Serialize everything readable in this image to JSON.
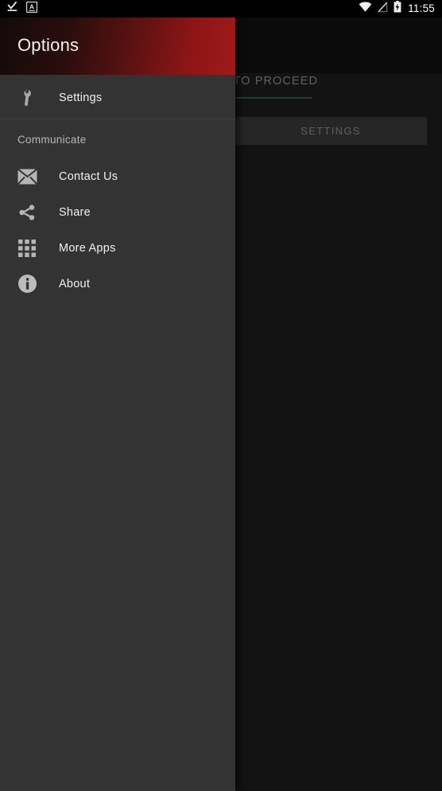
{
  "status_bar": {
    "time": "11:55",
    "left_icons": [
      {
        "name": "download-complete-icon"
      },
      {
        "name": "keyboard-input-icon",
        "glyph": "A"
      }
    ],
    "right_icons": [
      {
        "name": "wifi-icon"
      },
      {
        "name": "no-sim-signal-icon"
      },
      {
        "name": "battery-charging-icon"
      }
    ]
  },
  "drawer": {
    "title": "Options",
    "items": [
      {
        "label": "Settings",
        "icon": "wrench-icon"
      },
      {
        "label": "Contact Us",
        "icon": "envelope-icon"
      },
      {
        "label": "Share",
        "icon": "share-icon"
      },
      {
        "label": "More Apps",
        "icon": "grid-apps-icon"
      },
      {
        "label": "About",
        "icon": "info-circle-icon"
      }
    ],
    "section_header": "Communicate"
  },
  "background": {
    "proceed_text": "ENTER TO PROCEED",
    "settings_button": "SETTINGS"
  },
  "colors": {
    "drawer_bg": "#333333",
    "header_gradient_start": "#130a0a",
    "header_gradient_end": "#a01919",
    "page_bg": "#161616",
    "accent_underline": "#2b4541",
    "text_primary": "#f0f0f0",
    "text_secondary": "#b8b8b8",
    "text_disabled": "#6d6d6d"
  }
}
